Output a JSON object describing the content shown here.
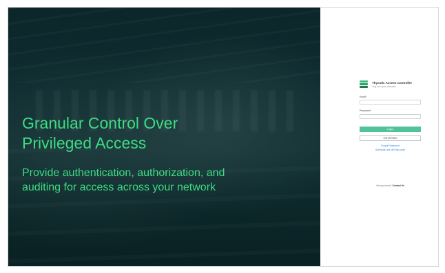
{
  "hero": {
    "title_line1": "Granular Control Over",
    "title_line2": "Privileged Access",
    "subtitle_line1": "Provide authentication, authorization, and",
    "subtitle_line2": "auditing for access across your network",
    "accent_color": "#3ddc84"
  },
  "login": {
    "brand_name": "Thycotic Access Controller",
    "brand_tagline": "Log in to your account",
    "email_label": "Email*",
    "email_value": "",
    "password_label": "Password*",
    "password_value": "",
    "login_button": "Login",
    "sso_button": "OKTA SSO",
    "forgot_password": "Forgot Password",
    "second_link": "Schedule one-off Pass auth",
    "footer_text": "Having issues?",
    "footer_link": "Contact Us",
    "button_color": "#52c29a"
  }
}
